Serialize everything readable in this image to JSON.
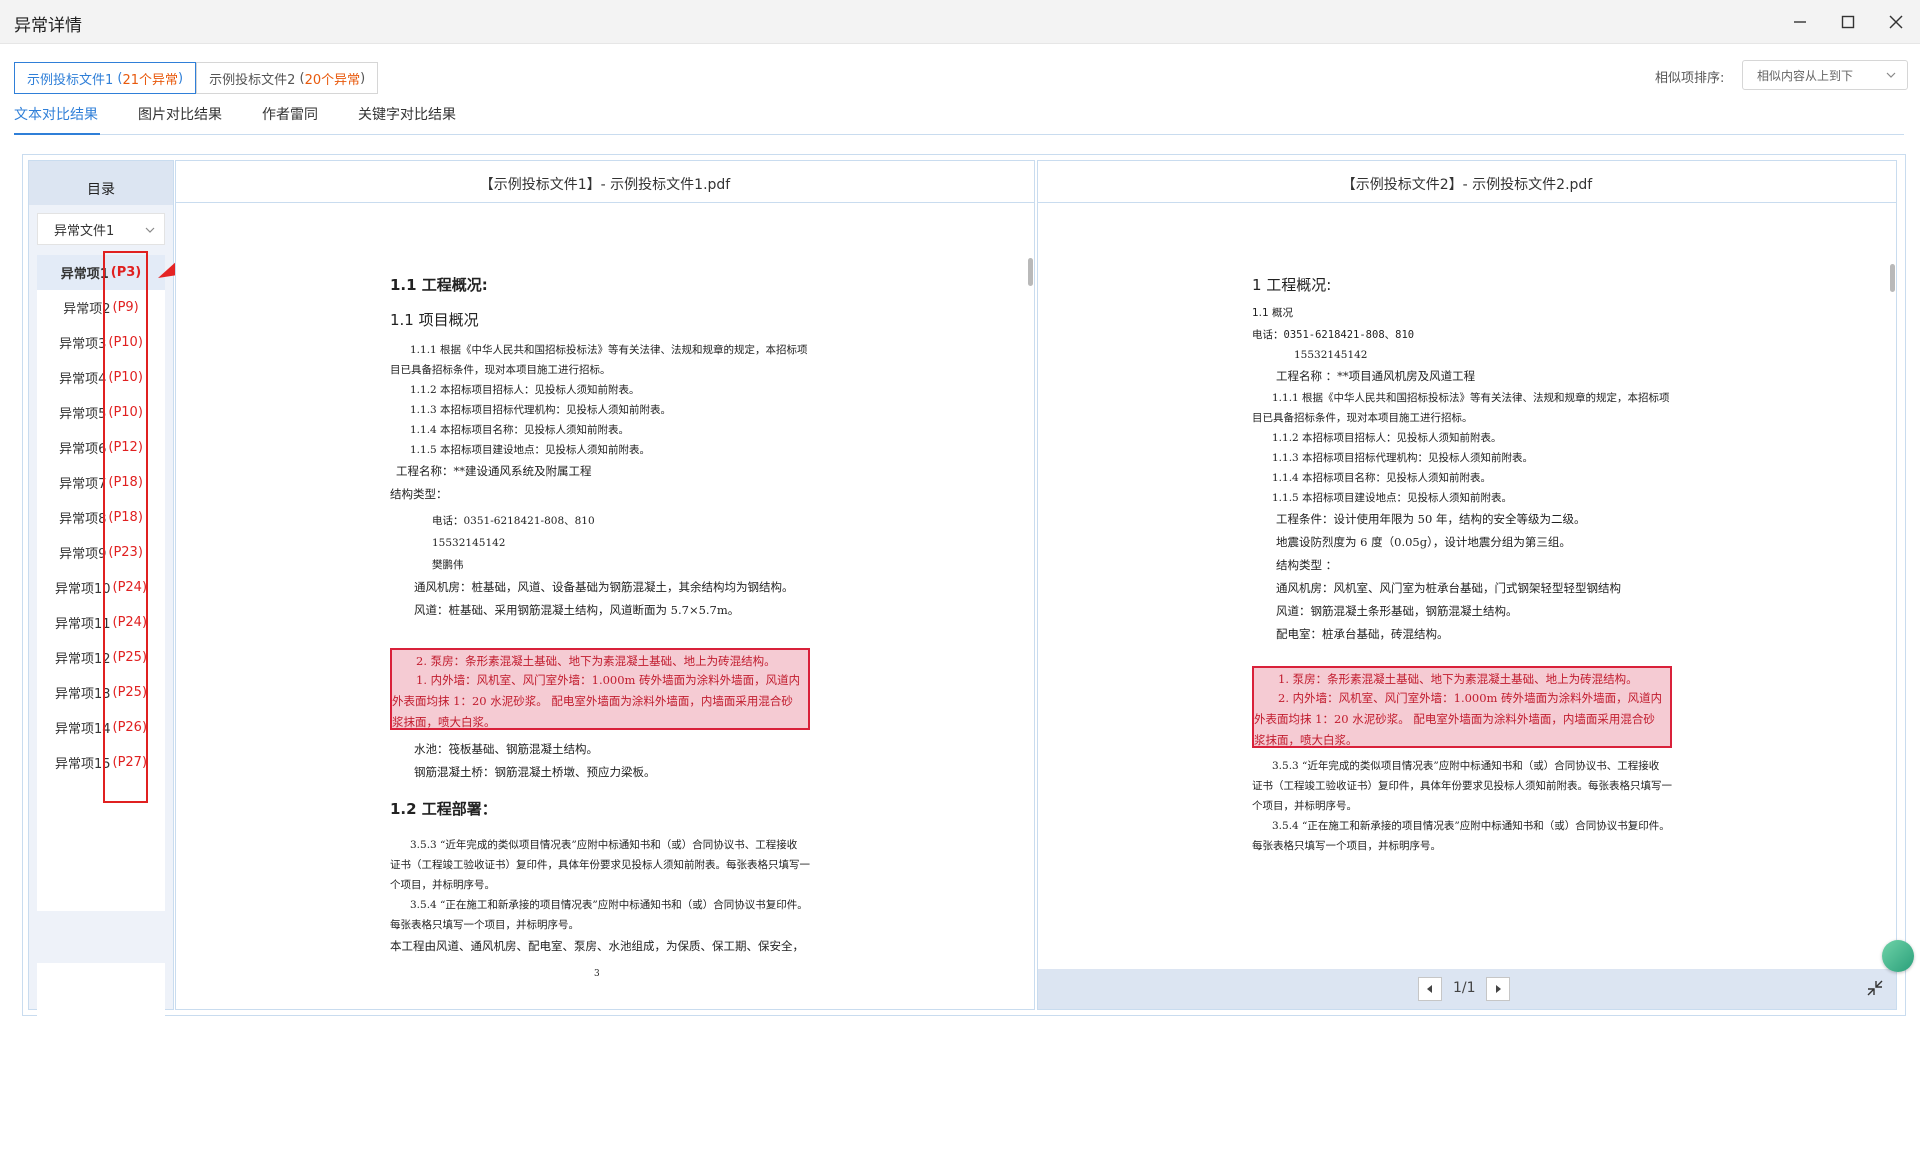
{
  "window": {
    "title": "异常详情"
  },
  "file_tabs": [
    {
      "name": "示例投标文件1",
      "count": "21个异常",
      "active": true
    },
    {
      "name": "示例投标文件2",
      "count": "20个异常",
      "active": false
    }
  ],
  "sort": {
    "label": "相似项排序:",
    "value": "相似内容从上到下"
  },
  "sub_tabs": [
    "文本对比结果",
    "图片对比结果",
    "作者雷同",
    "关键字对比结果"
  ],
  "sidebar": {
    "title": "目录",
    "doc_select": "异常文件1",
    "items": [
      {
        "label": "异常项1",
        "page": "(P3)"
      },
      {
        "label": "异常项2",
        "page": "(P9)"
      },
      {
        "label": "异常项3",
        "page": "(P10)"
      },
      {
        "label": "异常项4",
        "page": "(P10)"
      },
      {
        "label": "异常项5",
        "page": "(P10)"
      },
      {
        "label": "异常项6",
        "page": "(P12)"
      },
      {
        "label": "异常项7",
        "page": "(P18)"
      },
      {
        "label": "异常项8",
        "page": "(P18)"
      },
      {
        "label": "异常项9",
        "page": "(P23)"
      },
      {
        "label": "异常项10",
        "page": "(P24)"
      },
      {
        "label": "异常项11",
        "page": "(P24)"
      },
      {
        "label": "异常项12",
        "page": "(P25)"
      },
      {
        "label": "异常项13",
        "page": "(P25)"
      },
      {
        "label": "异常项14",
        "page": "(P26)"
      },
      {
        "label": "异常项15",
        "page": "(P27)"
      }
    ]
  },
  "left_doc": {
    "header": "【示例投标文件1】- 示例投标文件1.pdf",
    "h1": "1.1 工程概况:",
    "h2": "1.1  项目概况",
    "l1": "1.1.1 根据《中华人民共和国招标投标法》等有关法律、法规和规章的规定，本招标项",
    "l2": "目已具备招标条件，现对本项目施工进行招标。",
    "l3": "1.1.2  本招标项目招标人：见投标人须知前附表。",
    "l4": "1.1.3  本招标项目招标代理机构：见投标人须知前附表。",
    "l5": "1.1.4  本招标项目名称：见投标人须知前附表。",
    "l6": "1.1.5  本招标项目建设地点：见投标人须知前附表。",
    "l7": "工程名称：**建设通风系统及附属工程",
    "l8": "结构类型：",
    "l9": "电话：0351-6218421-808、810",
    "l10": "15532145142",
    "l11": "樊鹏伟",
    "l12": "通风机房：桩基础，风道、设备基础为钢筋混凝土，其余结构均为钢结构。",
    "l13": "风道：桩基础、采用钢筋混凝土结构，风道断面为 5.7×5.7m。",
    "hl1": "2. 泵房：条形素混凝土基础、地下为素混凝土基础、地上为砖混结构。",
    "hl2": "1. 内外墙：风机室、风门室外墙：1.000m 砖外墙面为涂料外墙面，风道内",
    "hl3": "外表面均抹 1：20 水泥砂浆。  配电室外墙面为涂料外墙面，内墙面采用混合砂",
    "hl4": "浆抹面，喷大白浆。",
    "l14": "水池：筏板基础、钢筋混凝土结构。",
    "l15": "钢筋混凝土桥：钢筋混凝土桥墩、预应力梁板。",
    "h3": "1.2 工程部署：",
    "l16": "3.5.3  “近年完成的类似项目情况表”应附中标通知书和（或）合同协议书、工程接收",
    "l17": "证书（工程竣工验收证书）复印件，具体年份要求见投标人须知前附表。每张表格只填写一",
    "l18": "个项目，并标明序号。",
    "l19": "3.5.4  “正在施工和新承接的项目情况表”应附中标通知书和（或）合同协议书复印件。",
    "l20": "每张表格只填写一个项目，并标明序号。",
    "l21": "本工程由风道、通风机房、配电室、泵房、水池组成，为保质、保工期、保安全，",
    "page_no": "3"
  },
  "right_doc": {
    "header": "【示例投标文件2】- 示例投标文件2.pdf",
    "h1": "1 工程概况:",
    "h2": "1.1 概况",
    "l1": "电话：0351-6218421-808、810",
    "l2": "15532145142",
    "l3": "工程名称 ：**项目通风机房及风道工程",
    "l4": "1.1.1 根据《中华人民共和国招标投标法》等有关法律、法规和规章的规定，本招标项",
    "l5": "目已具备招标条件，现对本项目施工进行招标。",
    "l6": "1.1.2  本招标项目招标人：见投标人须知前附表。",
    "l7": "1.1.3  本招标项目招标代理机构：见投标人须知前附表。",
    "l8": "1.1.4  本招标项目名称：见投标人须知前附表。",
    "l9": "1.1.5  本招标项目建设地点：见投标人须知前附表。",
    "l10": "工程条件：设计使用年限为 50 年，结构的安全等级为二级。",
    "l11": "地震设防烈度为 6 度（0.05g），设计地震分组为第三组。",
    "l12": "结构类型 ：",
    "l13": "通风机房：风机室、风门室为桩承台基础，门式钢架轻型轻型钢结构",
    "l14": "风道：钢筋混凝土条形基础，钢筋混凝土结构。",
    "l15": "配电室：桩承台基础，砖混结构。",
    "hl1": "1. 泵房：条形素混凝土基础、地下为素混凝土基础、地上为砖混结构。",
    "hl2": "2. 内外墙：风机室、风门室外墙：1.000m 砖外墙面为涂料外墙面，风道内",
    "hl3": "外表面均抹 1：20 水泥砂浆。  配电室外墙面为涂料外墙面，内墙面采用混合砂",
    "hl4": "浆抹面，喷大白浆。",
    "l16": "3.5.3  “近年完成的类似项目情况表”应附中标通知书和（或）合同协议书、工程接收",
    "l17": "证书（工程竣工验收证书）复印件，具体年份要求见投标人须知前附表。每张表格只填写一",
    "l18": "个项目，并标明序号。",
    "l19": "3.5.4  “正在施工和新承接的项目情况表”应附中标通知书和（或）合同协议书复印件。",
    "l20": "每张表格只填写一个项目，并标明序号。"
  },
  "pager": {
    "text": "1/1"
  },
  "colors": {
    "accent": "#2f7fd8",
    "highlight_border": "#d9213a",
    "highlight_fill": "#f1b9c4",
    "page_ref": "#e02020"
  },
  "icons": [
    "minimize-icon",
    "maximize-icon",
    "close-icon",
    "chevron-down-icon",
    "prev-page-icon",
    "next-page-icon",
    "collapse-icon",
    "assistant-icon",
    "annotation-arrow"
  ]
}
